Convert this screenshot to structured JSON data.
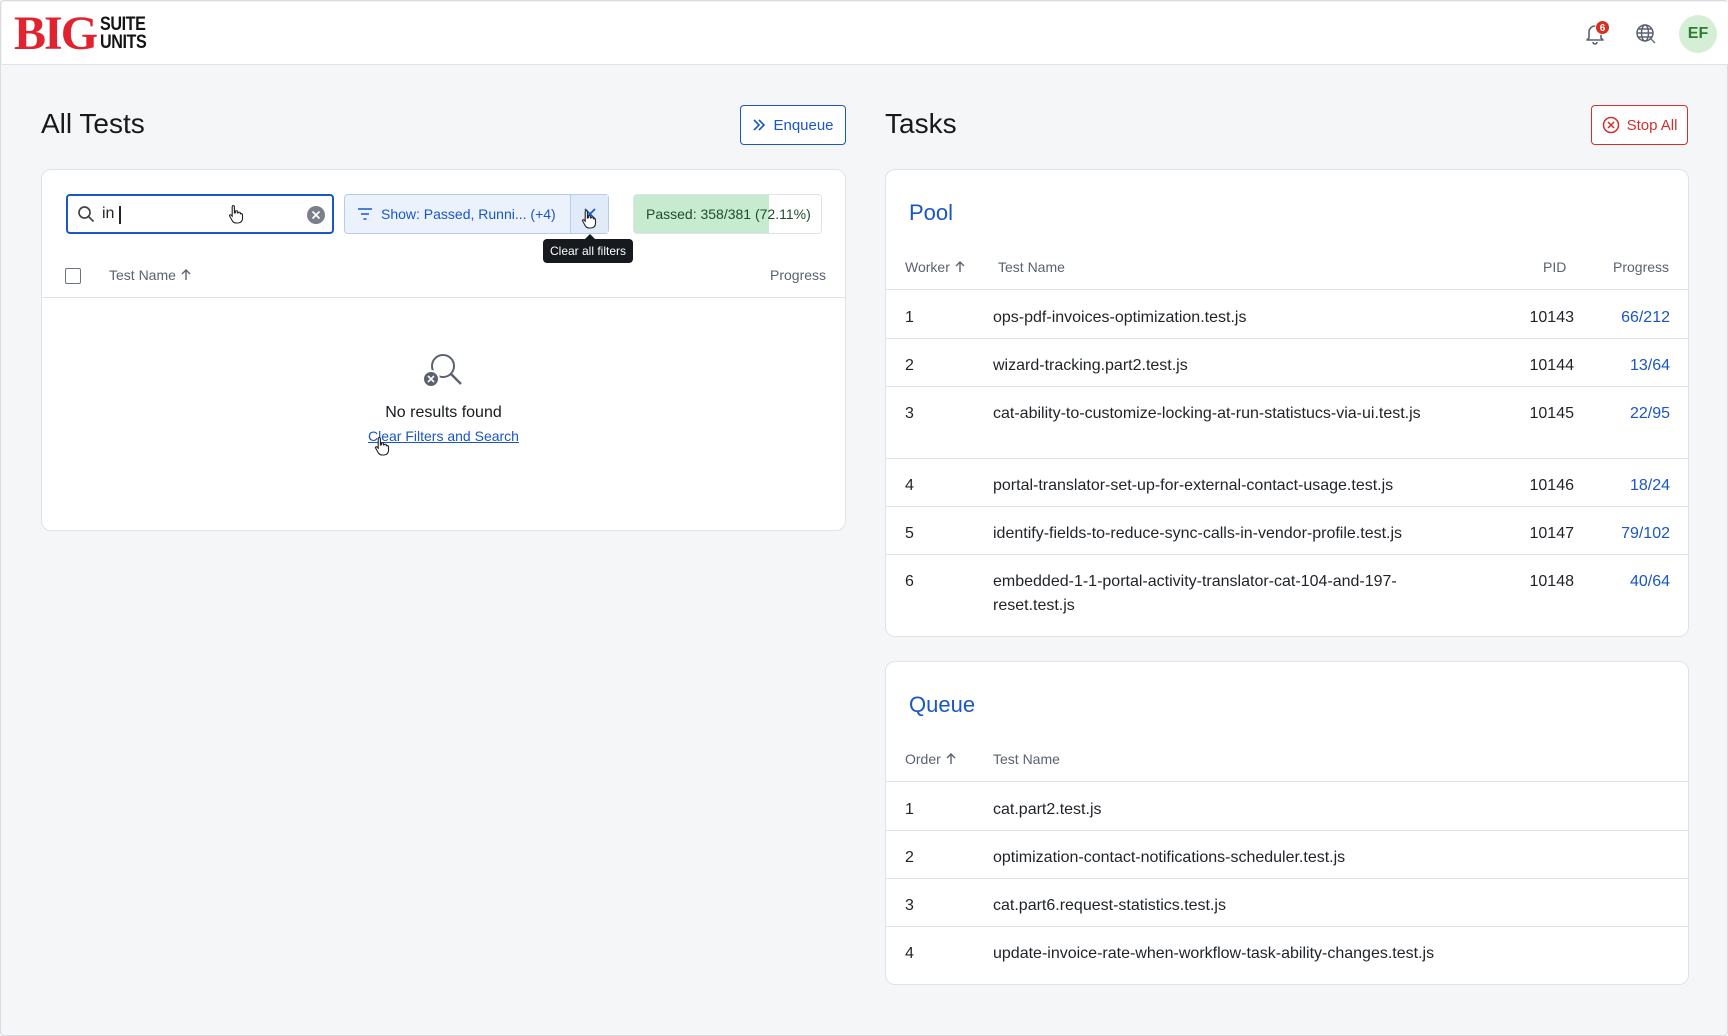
{
  "header": {
    "logo_big": "BIG",
    "logo_line1": "SUITE",
    "logo_line2": "UNITS",
    "notification_count": "6",
    "avatar_initials": "EF"
  },
  "all_tests": {
    "title": "All Tests",
    "enqueue_label": "Enqueue",
    "search_value": "in",
    "filter_label": "Show: Passed, Runni... (+4)",
    "clear_tooltip": "Clear all filters",
    "passed_text": "Passed: 358/381 (72.11%)",
    "passed_fraction": 0.7211,
    "col_test_name": "Test Name",
    "col_progress": "Progress",
    "empty_title": "No results found",
    "empty_link": "Clear Filters and Search"
  },
  "tasks": {
    "title": "Tasks",
    "stop_all_label": "Stop All",
    "pool": {
      "title": "Pool",
      "columns": {
        "worker": "Worker",
        "test_name": "Test Name",
        "pid": "PID",
        "progress": "Progress"
      },
      "rows": [
        {
          "worker": "1",
          "test_name": "ops-pdf-invoices-optimization.test.js",
          "pid": "10143",
          "progress": "66/212"
        },
        {
          "worker": "2",
          "test_name": "wizard-tracking.part2.test.js",
          "pid": "10144",
          "progress": "13/64"
        },
        {
          "worker": "3",
          "test_name": "cat-ability-to-customize-locking-at-run-statistucs-via-ui.test.js",
          "pid": "10145",
          "progress": "22/95"
        },
        {
          "worker": "4",
          "test_name": "portal-translator-set-up-for-external-contact-usage.test.js",
          "pid": "10146",
          "progress": "18/24"
        },
        {
          "worker": "5",
          "test_name": "identify-fields-to-reduce-sync-calls-in-vendor-profile.test.js",
          "pid": "10147",
          "progress": "79/102"
        },
        {
          "worker": "6",
          "test_name": "embedded-1-1-portal-activity-translator-cat-104-and-197-reset.test.js",
          "pid": "10148",
          "progress": "40/64"
        }
      ]
    },
    "queue": {
      "title": "Queue",
      "columns": {
        "order": "Order",
        "test_name": "Test Name"
      },
      "rows": [
        {
          "order": "1",
          "test_name": "cat.part2.test.js"
        },
        {
          "order": "2",
          "test_name": "optimization-contact-notifications-scheduler.test.js"
        },
        {
          "order": "3",
          "test_name": "cat.part6.request-statistics.test.js"
        },
        {
          "order": "4",
          "test_name": "update-invoice-rate-when-workflow-task-ability-changes.test.js"
        }
      ]
    }
  },
  "colors": {
    "accent": "#1a56c4",
    "danger": "#d32f2f",
    "logo_red": "#e0232f",
    "passed_fill": "#c7ebcf"
  },
  "icons": [
    "bell-icon",
    "globe-icon",
    "search-icon",
    "clear-circle-icon",
    "filter-icon",
    "close-x-icon",
    "double-chevron-right-icon",
    "stop-circle-icon",
    "sort-arrow-up-icon",
    "search-off-icon"
  ]
}
